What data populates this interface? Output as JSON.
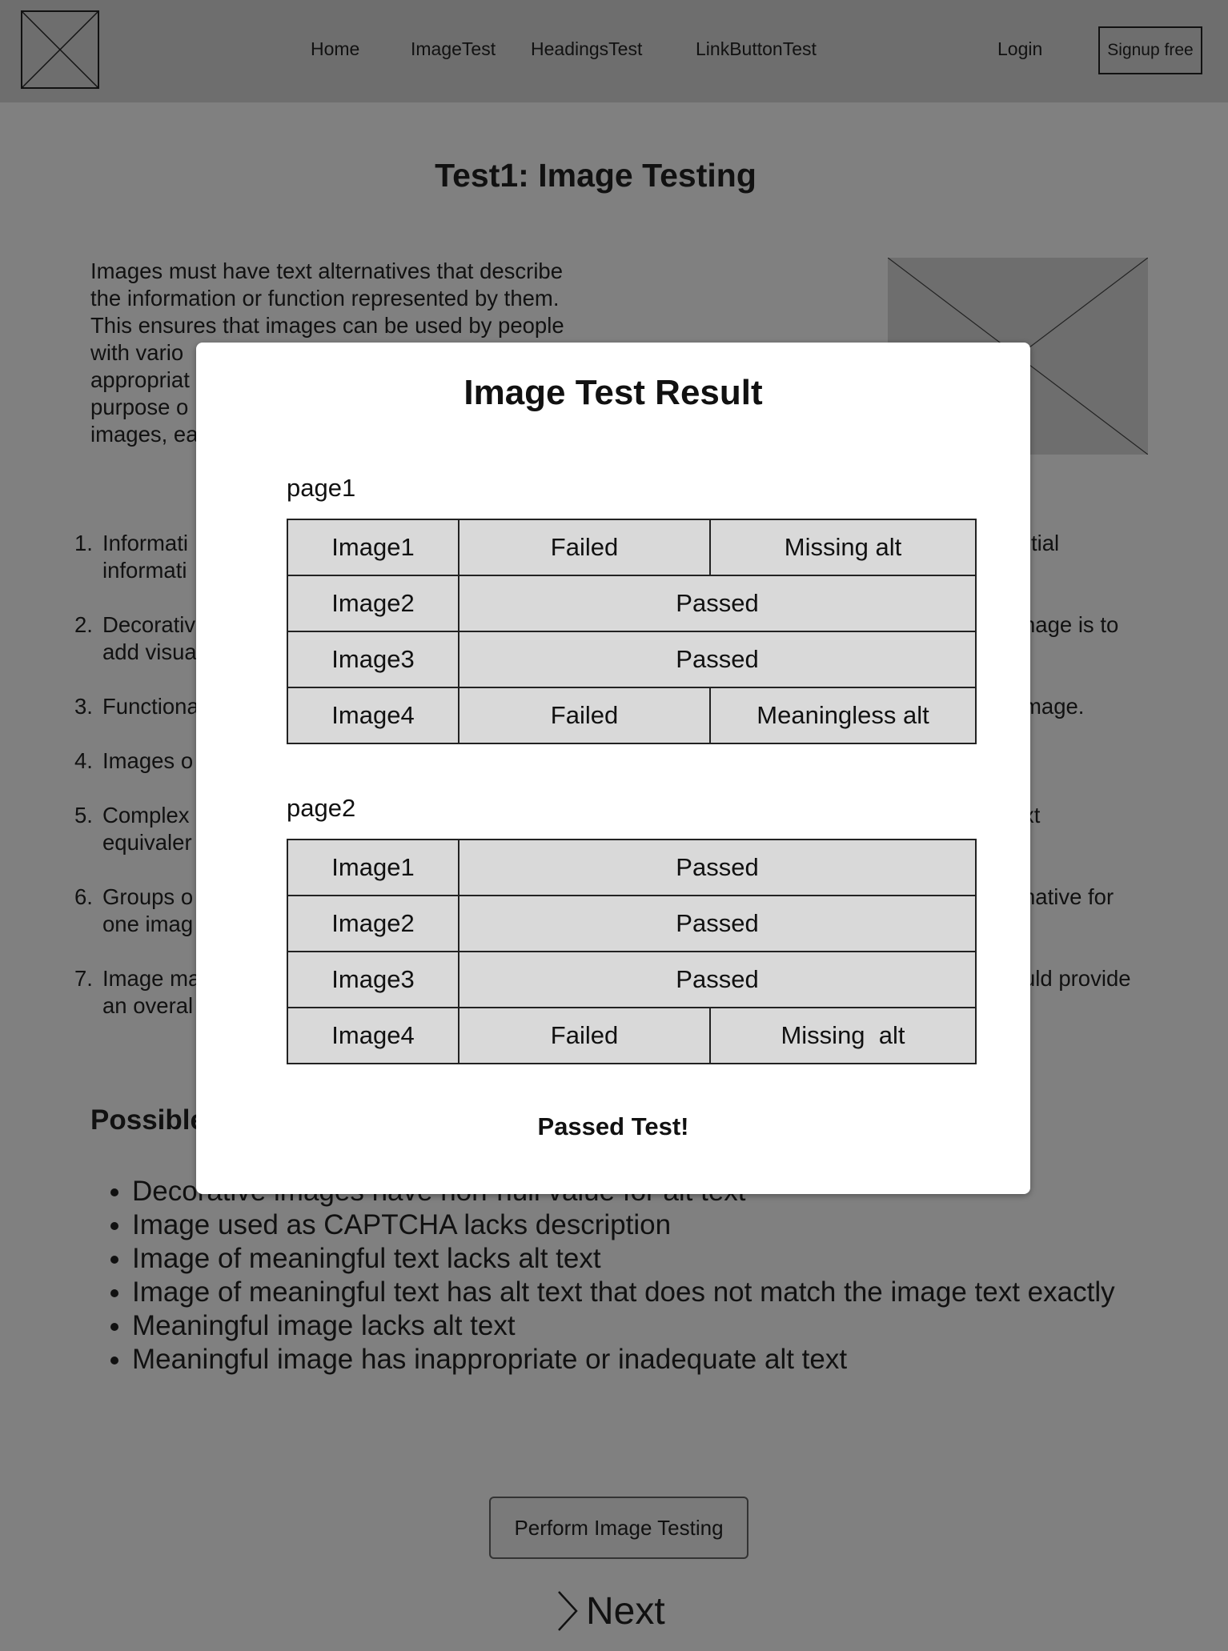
{
  "nav": {
    "home": "Home",
    "image_test": "ImageTest",
    "headings_test": "HeadingsTest",
    "link_button_test": "LinkButtonTest",
    "login": "Login",
    "signup": "Signup free"
  },
  "page": {
    "title": "Test1: Image Testing",
    "intro_lines": [
      "Images must have text alternatives that describe",
      "the information or function represented by them.",
      "This ensures that images can be used by people",
      "with vario",
      "appropriat",
      "purpose o",
      "images, ea"
    ],
    "rules": [
      {
        "num": "1.",
        "left": [
          "Informati",
          "informati"
        ],
        "right": [
          "tial",
          ""
        ]
      },
      {
        "num": "2.",
        "left": [
          "Decorativ",
          "add visua"
        ],
        "right": [
          "nage is to",
          ""
        ]
      },
      {
        "num": "3.",
        "left": [
          "Functiona"
        ],
        "right": [
          "mage."
        ]
      },
      {
        "num": "4.",
        "left": [
          "Images o"
        ],
        "right": [
          ""
        ]
      },
      {
        "num": "5.",
        "left": [
          "Complex",
          "equivaler"
        ],
        "right": [
          "xt",
          ""
        ]
      },
      {
        "num": "6.",
        "left": [
          "Groups o",
          "one imag"
        ],
        "right": [
          "native for",
          ""
        ]
      },
      {
        "num": "7.",
        "left": [
          "Image ma",
          "an overal"
        ],
        "right": [
          "uld provide",
          ""
        ]
      }
    ],
    "section_title": "Possible",
    "failures": [
      "Decorative images have non-null value for alt text",
      "Image used as CAPTCHA lacks description",
      "Image of meaningful text lacks alt text",
      "Image of meaningful text has alt text that does not match the image text exactly",
      "Meaningful image lacks alt text",
      "Meaningful image has inappropriate or inadequate alt text"
    ],
    "perform_button": "Perform Image Testing",
    "next_label": "Next"
  },
  "modal": {
    "title": "Image Test Result",
    "pages": [
      {
        "label": "page1",
        "rows": [
          {
            "image": "Image1",
            "status": "Failed",
            "reason": "Missing alt"
          },
          {
            "image": "Image2",
            "status": "Passed",
            "reason": ""
          },
          {
            "image": "Image3",
            "status": "Passed",
            "reason": ""
          },
          {
            "image": "Image4",
            "status": "Failed",
            "reason": "Meaningless alt"
          }
        ]
      },
      {
        "label": "page2",
        "rows": [
          {
            "image": "Image1",
            "status": "Passed",
            "reason": ""
          },
          {
            "image": "Image2",
            "status": "Passed",
            "reason": ""
          },
          {
            "image": "Image3",
            "status": "Passed",
            "reason": ""
          },
          {
            "image": "Image4",
            "status": "Failed",
            "reason": "Missing  alt"
          }
        ]
      }
    ],
    "result_message": "Passed Test!"
  }
}
